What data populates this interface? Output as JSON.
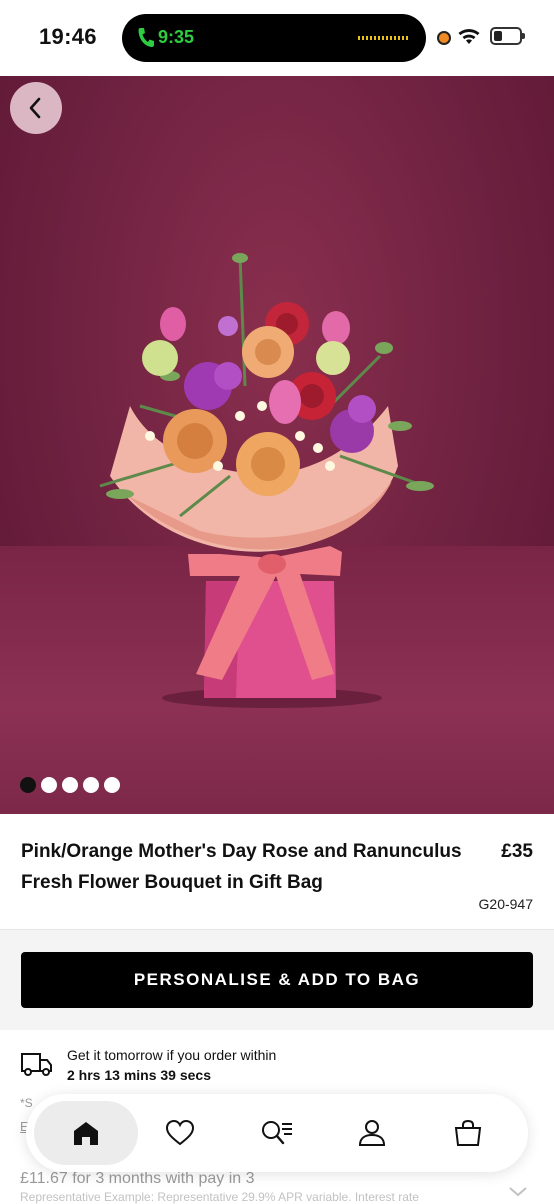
{
  "status_bar": {
    "time": "19:46",
    "call_time": "9:35"
  },
  "hero": {
    "image_alt_icon": "flower-bouquet-image",
    "carousel_count": 5,
    "carousel_active_index": 0
  },
  "product": {
    "title": "Pink/Orange Mother's Day Rose and Ranunculus Fresh Flower Bouquet in Gift Bag",
    "price": "£35",
    "code": "G20-947"
  },
  "cta": {
    "label": "PERSONALISE & ADD TO BAG"
  },
  "delivery": {
    "line1": "Get it tomorrow if you order within",
    "countdown": "2 hrs 13 mins 39 secs",
    "note": "*S",
    "link": "E"
  },
  "finance": {
    "headline": "£11.67 for 3 months with pay in 3",
    "subtext": "Representative Example: Representative 29.9% APR variable. Interest rate"
  },
  "tabbar": {
    "items": [
      "home-icon",
      "heart-icon",
      "search-list-icon",
      "account-icon",
      "bag-icon"
    ],
    "active": "home-icon"
  },
  "colors": {
    "hero_bg": "#6e2140",
    "cta_bg": "#000000",
    "call_green": "#2ecc40"
  }
}
